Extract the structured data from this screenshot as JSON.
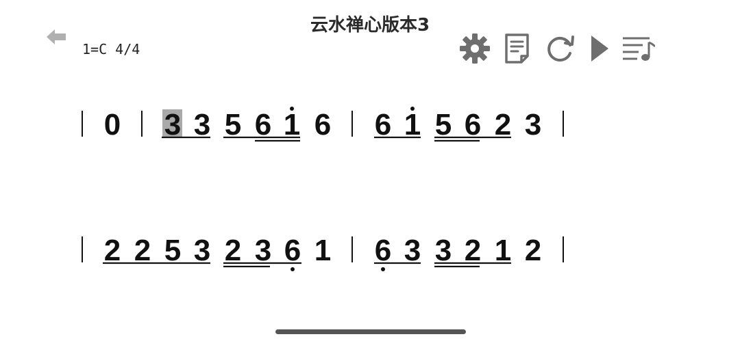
{
  "header": {
    "title": "云水禅心版本3",
    "key_signature": "1=C 4/4"
  },
  "toolbar": {
    "items": [
      {
        "name": "settings",
        "icon": "gear-icon"
      },
      {
        "name": "sheet",
        "icon": "document-icon"
      },
      {
        "name": "loop",
        "icon": "refresh-icon"
      },
      {
        "name": "play",
        "icon": "play-icon"
      },
      {
        "name": "playlist",
        "icon": "playlist-icon"
      }
    ]
  },
  "colors": {
    "icon": "#6e6e6e",
    "back_arrow": "#b0b0b0",
    "highlight": "#a9a9a9"
  },
  "score": {
    "highlighted_note": "3",
    "rows": [
      {
        "notes": [
          {
            "text": "0"
          },
          {
            "text": "3",
            "highlight": true
          },
          {
            "text": "3"
          },
          {
            "text": "5"
          },
          {
            "text": "6"
          },
          {
            "text": "1",
            "dot_above": true
          },
          {
            "text": "6"
          },
          {
            "text": "6"
          },
          {
            "text": "1",
            "dot_above": true
          },
          {
            "text": "5"
          },
          {
            "text": "6"
          },
          {
            "text": "2"
          },
          {
            "text": "3"
          }
        ]
      },
      {
        "notes": [
          {
            "text": "2"
          },
          {
            "text": "2"
          },
          {
            "text": "5"
          },
          {
            "text": "3"
          },
          {
            "text": "2"
          },
          {
            "text": "3"
          },
          {
            "text": "6",
            "dot_below": true
          },
          {
            "text": "1"
          },
          {
            "text": "6",
            "dot_below": true
          },
          {
            "text": "3"
          },
          {
            "text": "3"
          },
          {
            "text": "2"
          },
          {
            "text": "1"
          },
          {
            "text": "2"
          }
        ]
      }
    ]
  }
}
